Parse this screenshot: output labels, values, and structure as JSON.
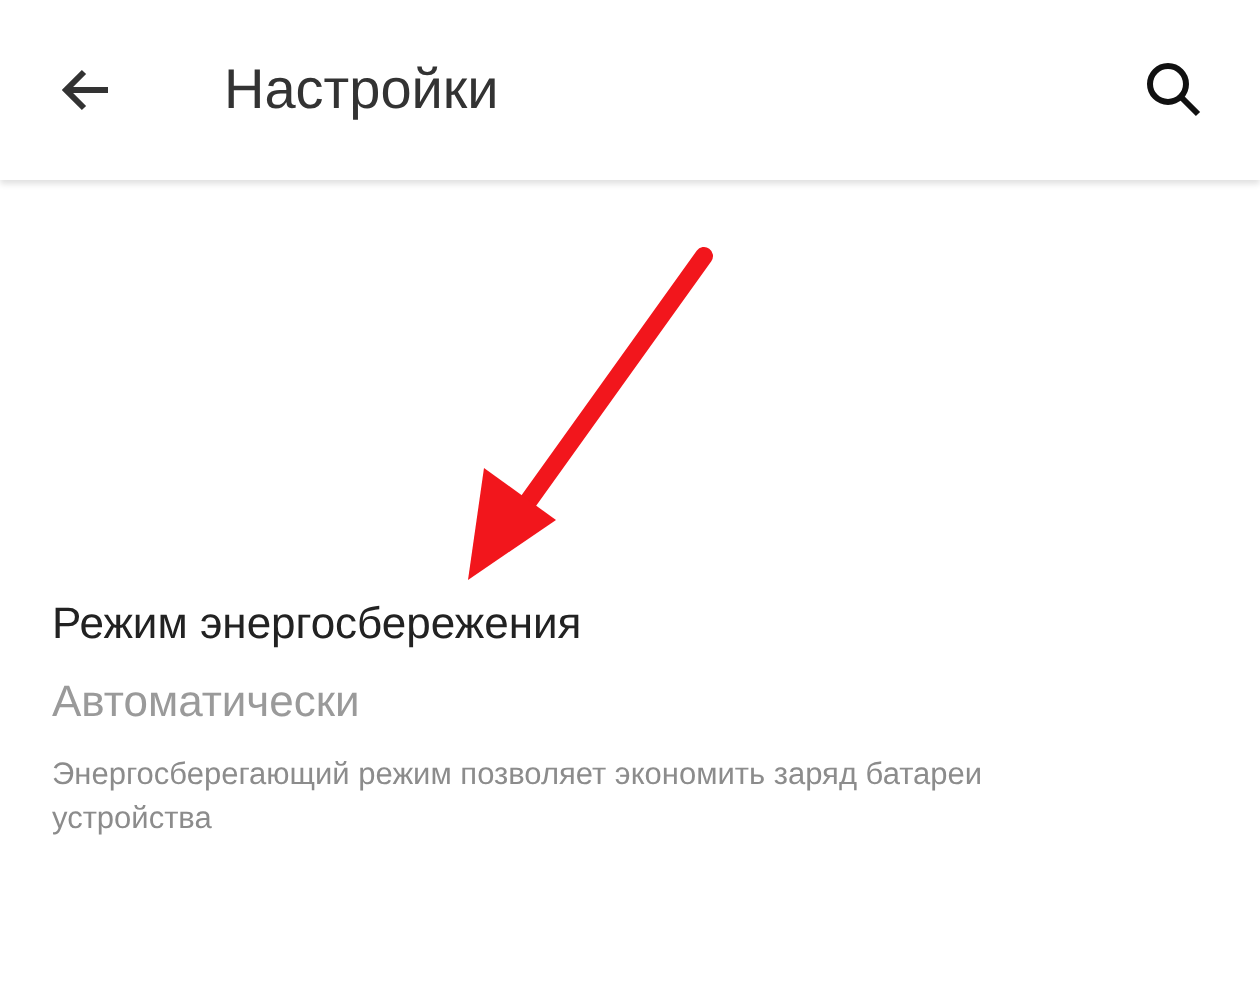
{
  "app_bar": {
    "title": "Настройки"
  },
  "setting": {
    "title": "Режим энергосбережения",
    "value": "Автоматически",
    "description": "Энергосберегающий режим позволяет экономить заряд батареи устройства"
  }
}
